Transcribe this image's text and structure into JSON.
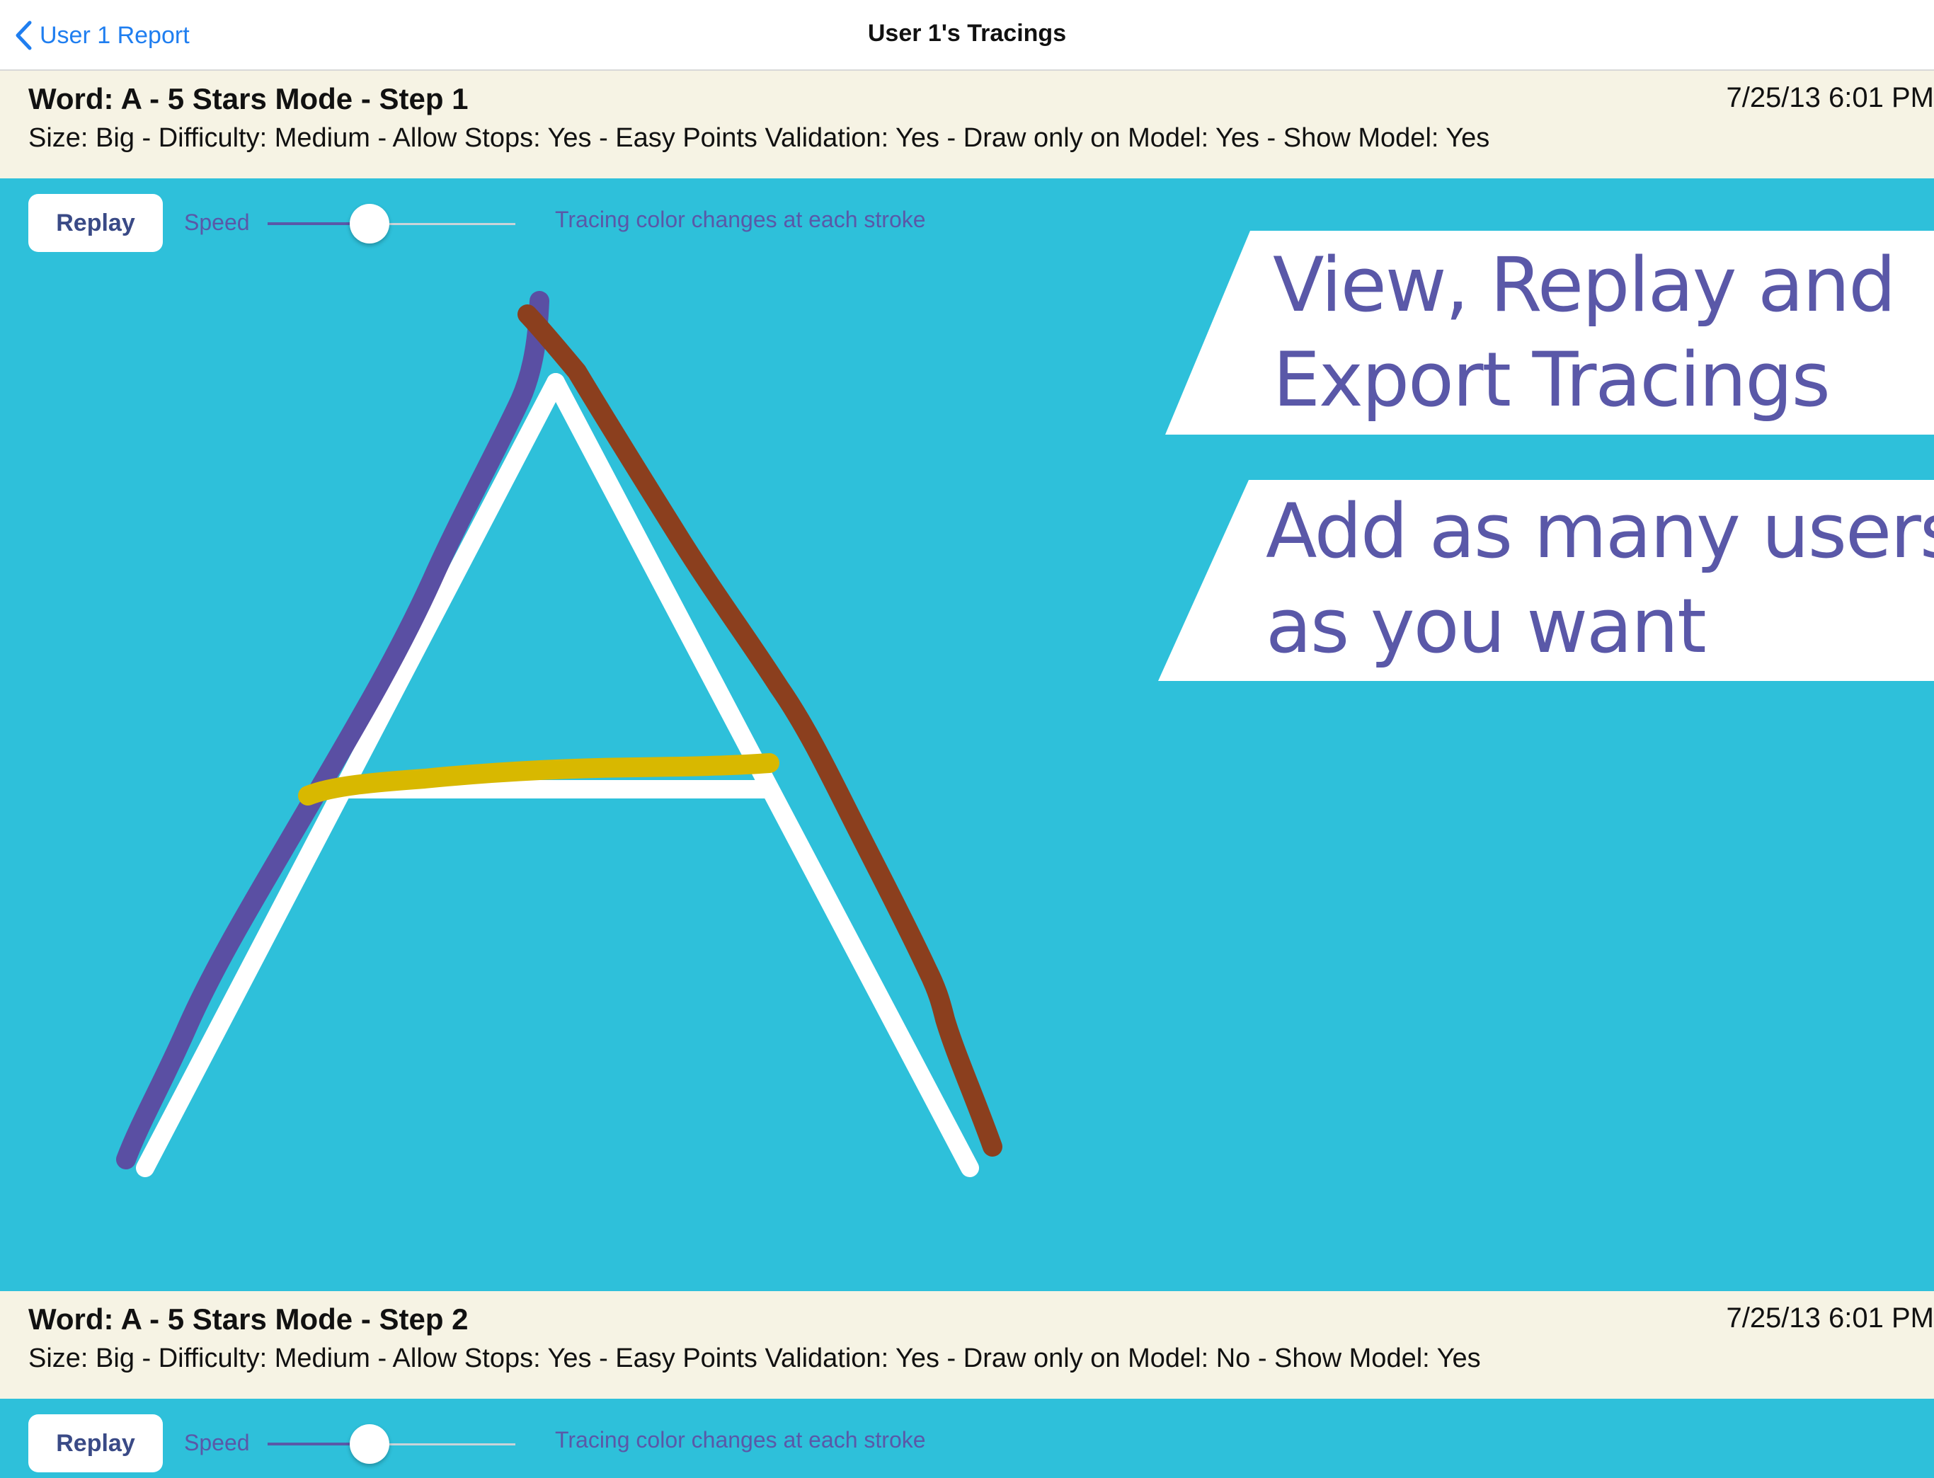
{
  "nav": {
    "back_label": "User 1 Report",
    "title": "User 1's Tracings"
  },
  "entries": [
    {
      "title": "Word: A  - 5 Stars Mode - Step 1",
      "date": "7/25/13 6:01 PM",
      "settings": "Size: Big - Difficulty: Medium - Allow Stops: Yes - Easy Points Validation: Yes - Draw only on Model: Yes - Show Model: Yes",
      "replay_label": "Replay",
      "speed_label": "Speed",
      "speed_value": 0.42,
      "hint": "Tracing color changes at each stroke"
    },
    {
      "title": "Word: A  - 5 Stars Mode - Step 2",
      "date": "7/25/13 6:01 PM",
      "settings": "Size: Big - Difficulty: Medium - Allow Stops: Yes - Easy Points Validation: Yes - Draw only on Model: No - Show Model: Yes",
      "replay_label": "Replay",
      "speed_label": "Speed",
      "speed_value": 0.42,
      "hint": "Tracing color changes at each stroke"
    }
  ],
  "promo": {
    "banner1_line1": "View, Replay and",
    "banner1_line2": "Export Tracings",
    "banner2_line1": "Add as many users",
    "banner2_line2": "as you want"
  },
  "colors": {
    "background": "#2ec0da",
    "accent": "#5a58a8",
    "model": "#ffffff",
    "stroke_1": "#5a4fa3",
    "stroke_2": "#8b3f1e",
    "stroke_3": "#d8b800"
  },
  "icons": {
    "back": "chevron-left-icon"
  }
}
